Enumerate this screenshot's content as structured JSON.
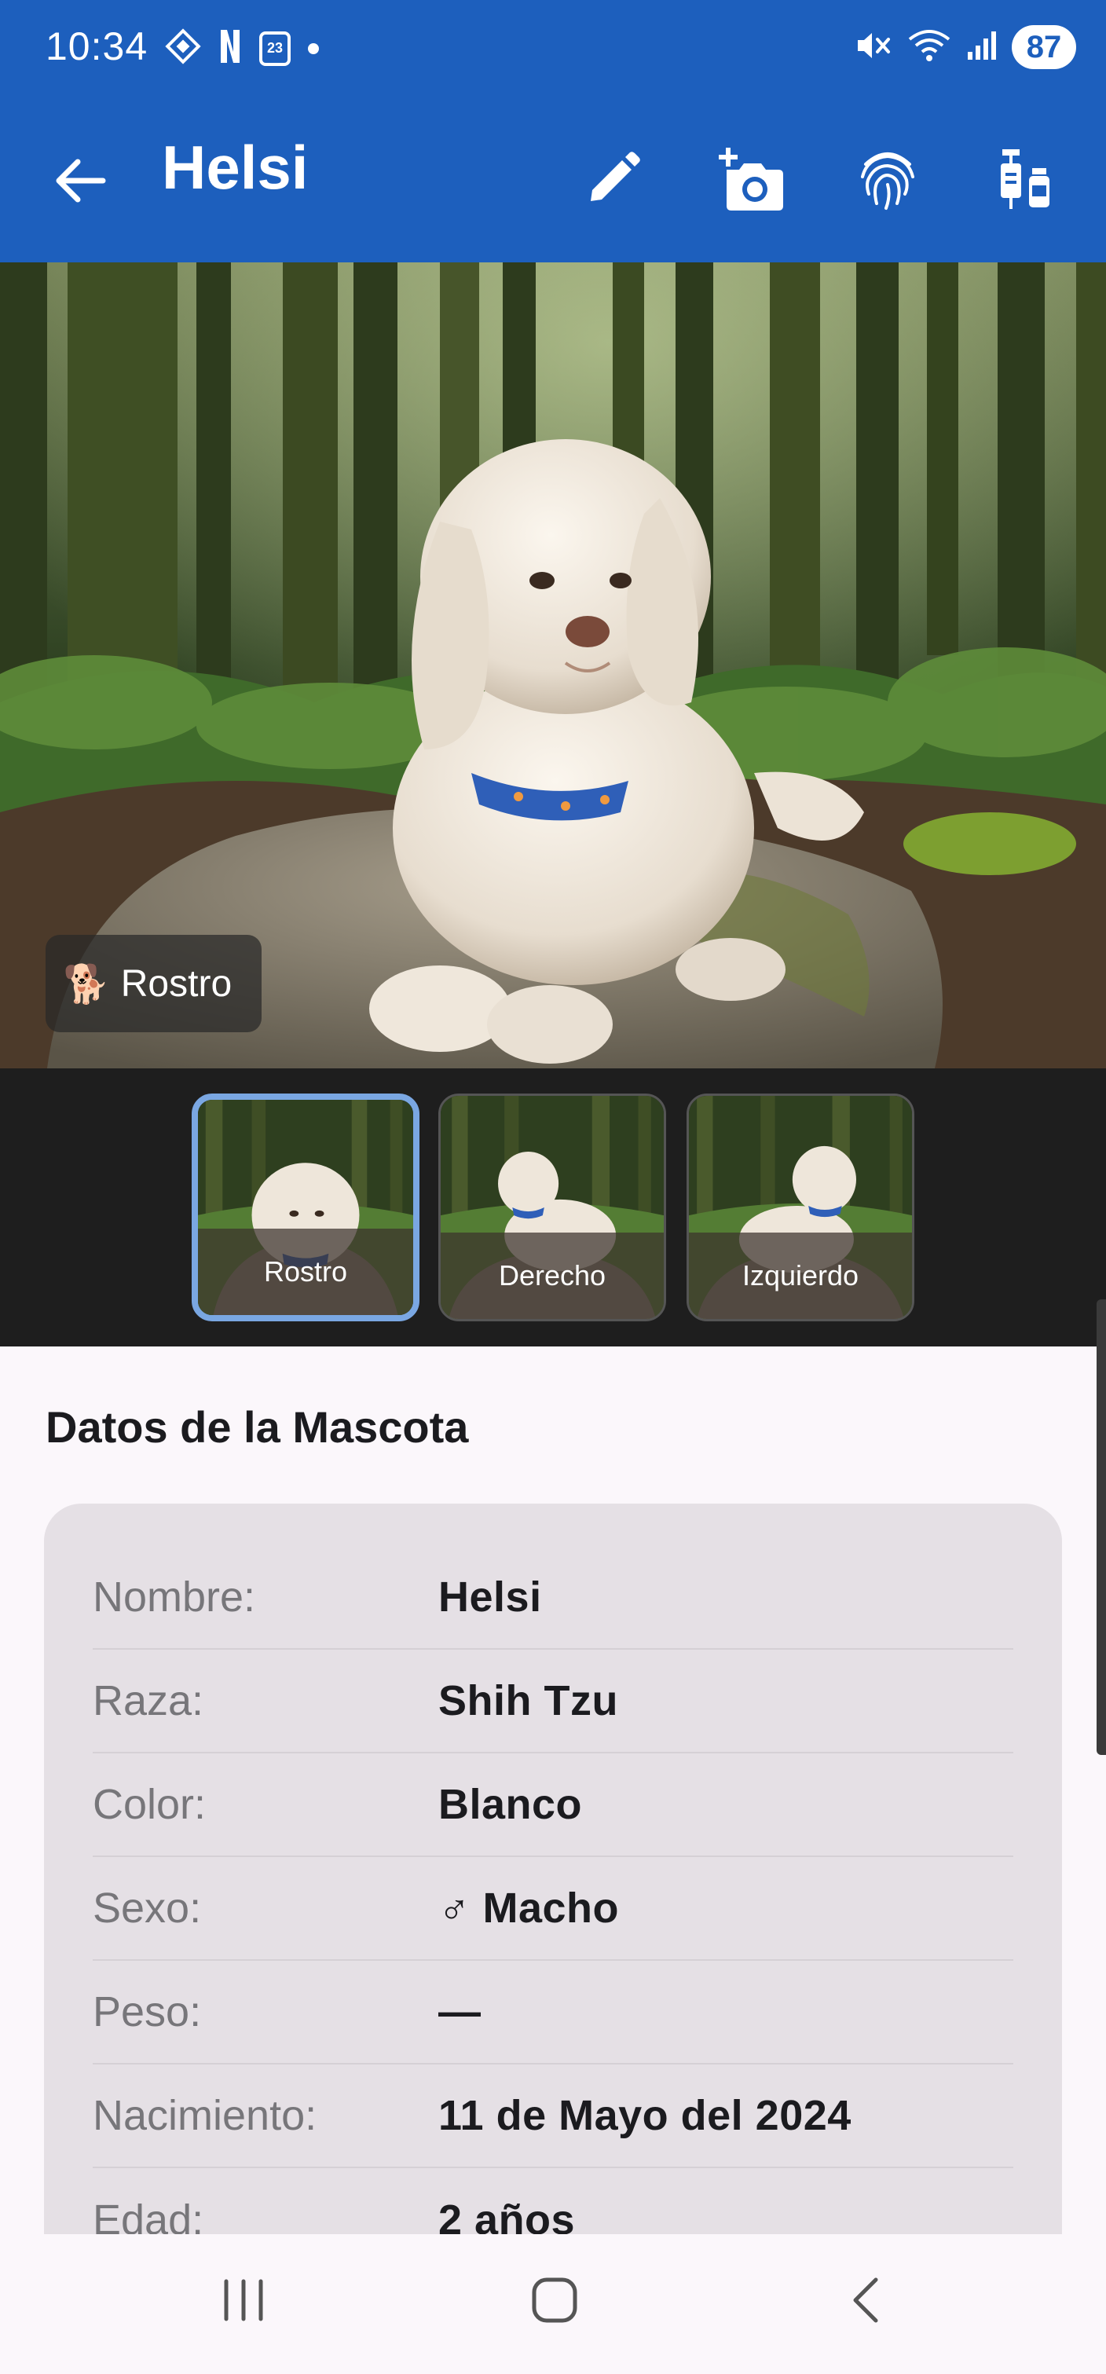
{
  "status_bar": {
    "time": "10:34",
    "calendar_day": "23",
    "battery": "87"
  },
  "app_bar": {
    "title": "Helsi",
    "actions": [
      "edit-icon",
      "add-photo-icon",
      "fingerprint-icon",
      "vaccine-icon"
    ]
  },
  "hero": {
    "chip_emoji": "🐕",
    "chip_label": "Rostro"
  },
  "thumbnails": [
    {
      "label": "Rostro",
      "selected": true
    },
    {
      "label": "Derecho",
      "selected": false
    },
    {
      "label": "Izquierdo",
      "selected": false
    }
  ],
  "details": {
    "section_title": "Datos de la Mascota",
    "rows": [
      {
        "label": "Nombre:",
        "value": "Helsi"
      },
      {
        "label": "Raza:",
        "value": "Shih Tzu"
      },
      {
        "label": "Color:",
        "value": "Blanco"
      },
      {
        "label": "Sexo:",
        "value": "♂ Macho"
      },
      {
        "label": "Peso:",
        "value": "—"
      },
      {
        "label": "Nacimiento:",
        "value": "11 de Mayo del 2024"
      },
      {
        "label": "Edad:",
        "value": "2 años"
      }
    ]
  },
  "colors": {
    "app_bar": "#1d5fbd",
    "thumb_selected_border": "#7aa7e2",
    "card_bg": "#e5e0e5"
  }
}
